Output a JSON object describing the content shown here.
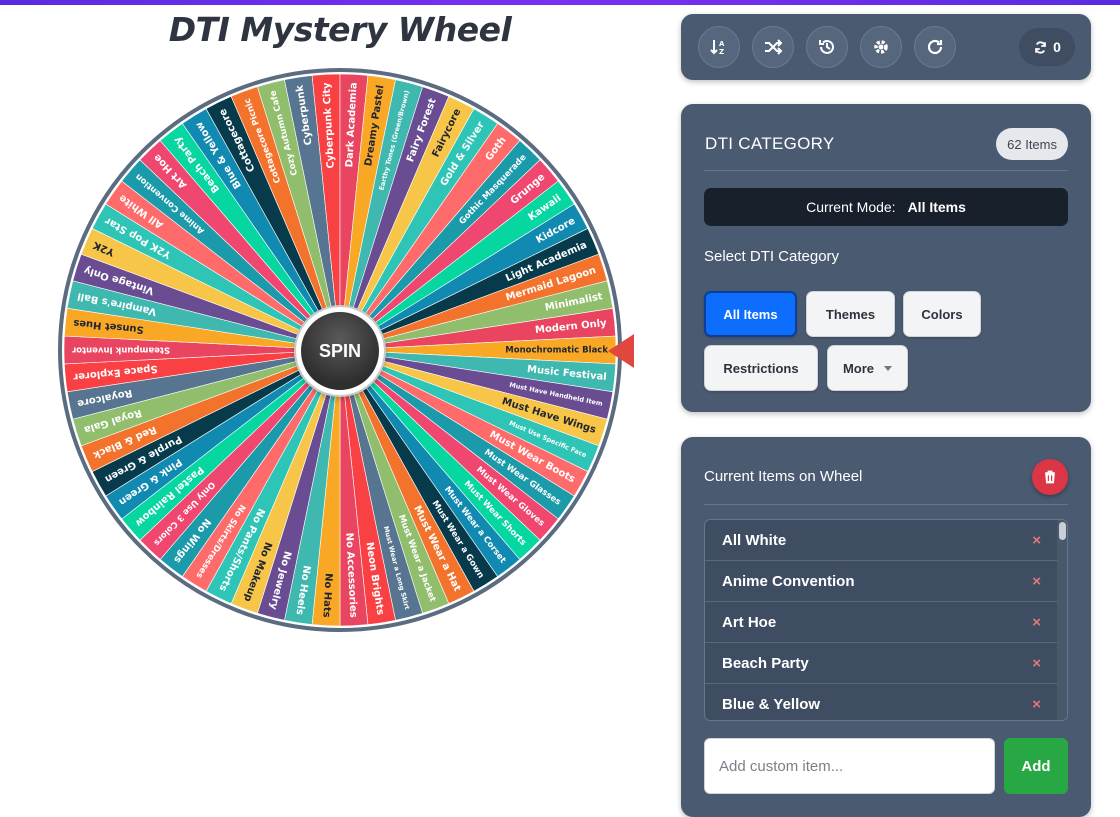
{
  "title": "DTI Mystery Wheel",
  "wheel": {
    "spin_label": "SPIN",
    "colors": [
      "#e94560",
      "#f9a826",
      "#3fb8af",
      "#6a4c93",
      "#f7c548",
      "#2ec4b6",
      "#ff6b6b",
      "#1b9aaa",
      "#ef476f",
      "#06d6a0",
      "#118ab2",
      "#073b4c",
      "#f3722c",
      "#90be6d",
      "#577590",
      "#f94144"
    ],
    "segments": [
      "Modern Only",
      "Monochromatic Black",
      "Music Festival",
      "Must Have Handheld Item",
      "Must Have Wings",
      "Must Use Specific Face",
      "Must Wear Boots",
      "Must Wear Glasses",
      "Must Wear Gloves",
      "Must Wear Shorts",
      "Must Wear a Corset",
      "Must Wear a Gown",
      "Must Wear a Hat",
      "Must Wear a Jacket",
      "Must Wear a Long Skirt",
      "Neon Brights",
      "No Accessories",
      "No Hats",
      "No Heels",
      "No Jewelry",
      "No Makeup",
      "No Pants/Shorts",
      "No Skirts/Dresses",
      "No Wings",
      "Only Use 3 Colors",
      "Pastel Rainbow",
      "Pink & Green",
      "Purple & Green",
      "Red & Black",
      "Royal Gala",
      "Royalcore",
      "Space Explorer",
      "Steampunk Inventor",
      "Sunset Hues",
      "Vampire's Ball",
      "Vintage Only",
      "Y2K",
      "Y2K Pop Star",
      "All White",
      "Anime Convention",
      "Art Hoe",
      "Beach Party",
      "Blue & Yellow",
      "Cottagecore",
      "Cottagecore Picnic",
      "Cozy Autumn Cafe",
      "Cyberpunk",
      "Cyberpunk City",
      "Dark Academia",
      "Dreamy Pastel",
      "Earthy Tones (Green/Brown)",
      "Fairy Forest",
      "Fairycore",
      "Gold & Silver",
      "Goth",
      "Gothic Masquerade",
      "Grunge",
      "Kawaii",
      "Kidcore",
      "Light Academia",
      "Mermaid Lagoon",
      "Minimalist"
    ]
  },
  "toolbar": {
    "buttons": [
      "sort-icon",
      "shuffle-icon",
      "history-icon",
      "settings-icon",
      "redo-icon"
    ],
    "counter_value": "0"
  },
  "category": {
    "title": "DTI CATEGORY",
    "count_badge": "62 Items",
    "mode_label": "Current Mode:",
    "mode_value": "All Items",
    "select_label": "Select DTI Category",
    "buttons": {
      "all": "All Items",
      "themes": "Themes",
      "colors": "Colors",
      "restrictions": "Restrictions",
      "more": "More"
    }
  },
  "items_panel": {
    "title": "Current Items on Wheel",
    "items": [
      "All White",
      "Anime Convention",
      "Art Hoe",
      "Beach Party",
      "Blue & Yellow"
    ],
    "remove_symbol": "×",
    "add_placeholder": "Add custom item...",
    "add_label": "Add"
  }
}
